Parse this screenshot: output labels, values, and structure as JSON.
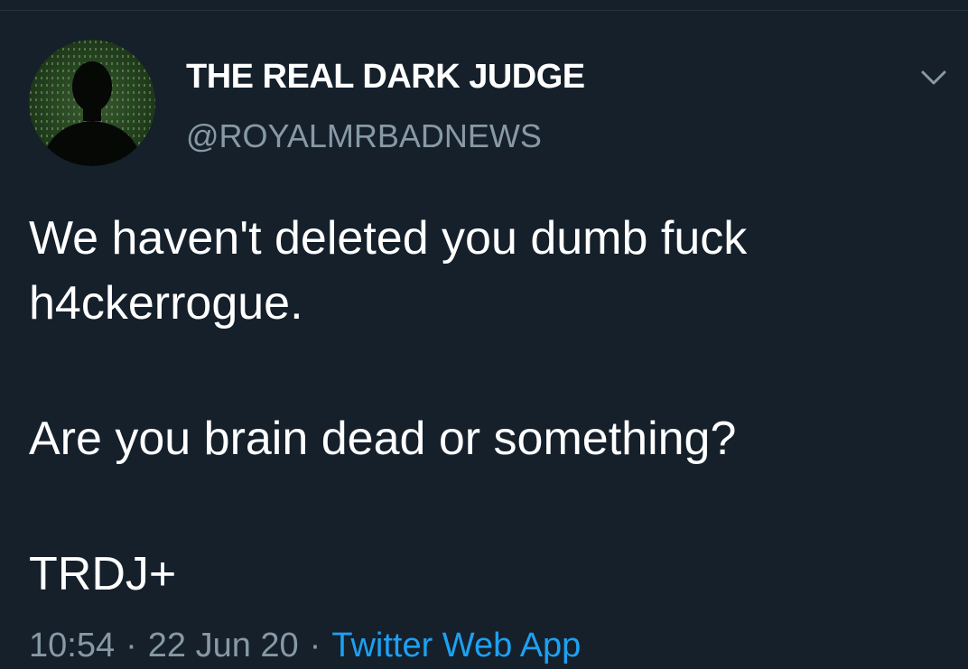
{
  "theme": {
    "background": "#15202b",
    "primary_text": "#ffffff",
    "secondary_text": "#8899a6",
    "link": "#1da1f2"
  },
  "author": {
    "display_name": "THE REAL DARK JUDGE",
    "handle": "@ROYALMRBADNEWS",
    "avatar_icon": "silhouette-avatar"
  },
  "tweet": {
    "lines": [
      "We haven't deleted you dumb fuck h4ckerrogue.",
      "Are you brain dead or something?",
      "TRDJ+"
    ]
  },
  "meta": {
    "time": "10:54",
    "date": "22 Jun 20",
    "separator": "·",
    "source": "Twitter Web App"
  },
  "menu": {
    "icon": "chevron-down-icon"
  }
}
